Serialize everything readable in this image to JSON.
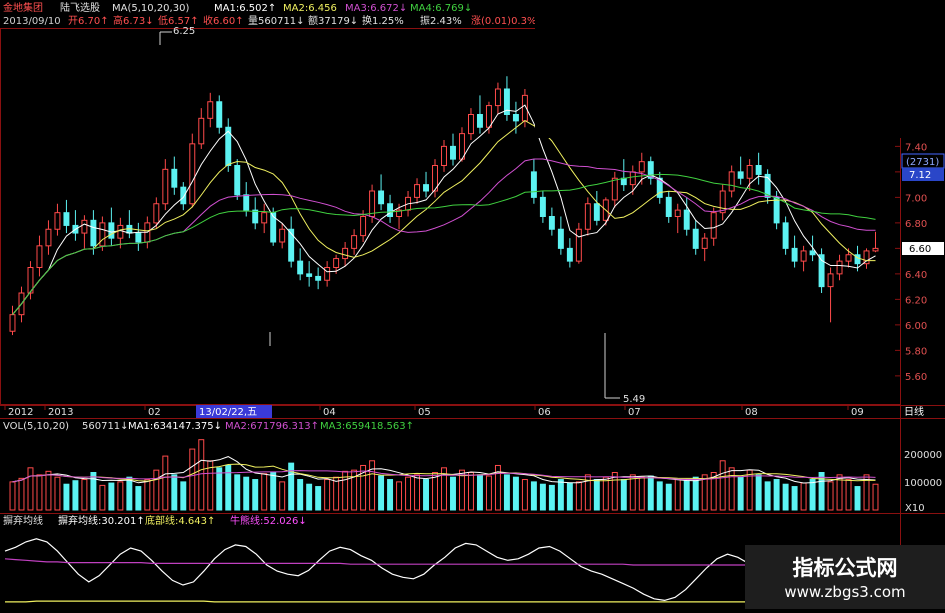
{
  "header": {
    "stock": "金地集团",
    "formula": "陆飞选股",
    "ma_label": "MA(5,10,20,30)",
    "ma1": "MA1:6.502↑",
    "ma2": "MA2:6.456",
    "ma3": "MA3:6.672↓",
    "ma4": "MA4:6.769↓",
    "date": "2013/09/10",
    "open": "开6.70↑",
    "high": "高6.73↓",
    "low": "低6.57↑",
    "close": "收6.60↑",
    "volume": "量560711↓",
    "amount": "额37179↓",
    "turnover": "换1.25%",
    "amplitude": "振2.43%",
    "change": "涨(0.01)0.3%"
  },
  "vol_header": {
    "label": "VOL(5,10,20)",
    "value": "560711↓",
    "ma1": "MA1:634147.375↓",
    "ma2": "MA2:671796.313↑",
    "ma3": "MA3:659418.563↑"
  },
  "ind_header": {
    "name": "摒弃均线",
    "line1": "摒弃均线:30.201↑",
    "line2": "底部线:4.643↑",
    "line3": "牛熊线:52.026↓"
  },
  "annotations": {
    "high_mark": "6.25",
    "low_mark": "5.49",
    "cursor_date": "13/02/22,五",
    "period": "日线",
    "ref_code": "(2731)",
    "ref_price": "7.12",
    "current_price": "6.60",
    "vol_unit": "X10"
  },
  "axis": {
    "x_labels": [
      "2012",
      "2013",
      "02",
      "04",
      "05",
      "06",
      "07",
      "08",
      "09"
    ],
    "price_ticks": [
      "7.40",
      "7.20",
      "7.00",
      "6.80",
      "6.60",
      "6.40",
      "6.20",
      "6.00",
      "5.80",
      "5.60"
    ],
    "vol_ticks": [
      "200000",
      "100000"
    ]
  },
  "colors": {
    "up": "#ff4a4a",
    "down": "#5cf2f2",
    "ma1": "#ffffff",
    "ma2": "#f0f060",
    "ma3": "#d050d0",
    "ma4": "#40d040",
    "grid": "#8a1010"
  },
  "watermark": {
    "main": "指标公式网",
    "sub": "www.zbgs3.com"
  },
  "chart_data": {
    "type": "candlestick",
    "title": "金地集团",
    "period": "日线",
    "ylim": [
      5.45,
      7.45
    ],
    "candles": [
      [
        5.95,
        6.15,
        5.92,
        6.08
      ],
      [
        6.08,
        6.3,
        6.02,
        6.25
      ],
      [
        6.25,
        6.5,
        6.2,
        6.45
      ],
      [
        6.45,
        6.7,
        6.38,
        6.62
      ],
      [
        6.62,
        6.82,
        6.55,
        6.75
      ],
      [
        6.75,
        6.95,
        6.7,
        6.88
      ],
      [
        6.88,
        6.98,
        6.72,
        6.78
      ],
      [
        6.78,
        6.9,
        6.66,
        6.72
      ],
      [
        6.72,
        6.86,
        6.6,
        6.82
      ],
      [
        6.82,
        6.9,
        6.55,
        6.62
      ],
      [
        6.62,
        6.85,
        6.58,
        6.8
      ],
      [
        6.8,
        6.92,
        6.62,
        6.68
      ],
      [
        6.68,
        6.84,
        6.6,
        6.78
      ],
      [
        6.78,
        6.9,
        6.68,
        6.72
      ],
      [
        6.72,
        6.8,
        6.58,
        6.65
      ],
      [
        6.65,
        6.85,
        6.6,
        6.8
      ],
      [
        6.8,
        7.0,
        6.76,
        6.95
      ],
      [
        6.95,
        7.3,
        6.9,
        7.22
      ],
      [
        7.22,
        7.32,
        7.02,
        7.08
      ],
      [
        7.08,
        7.12,
        6.9,
        6.95
      ],
      [
        6.95,
        7.5,
        6.92,
        7.42
      ],
      [
        7.42,
        7.7,
        7.38,
        7.62
      ],
      [
        7.62,
        7.82,
        7.55,
        7.75
      ],
      [
        7.75,
        7.8,
        7.5,
        7.55
      ],
      [
        7.55,
        7.62,
        7.2,
        7.25
      ],
      [
        7.25,
        7.3,
        6.98,
        7.02
      ],
      [
        7.02,
        7.12,
        6.85,
        6.9
      ],
      [
        6.9,
        7.0,
        6.75,
        6.8
      ],
      [
        6.8,
        6.95,
        6.72,
        6.88
      ],
      [
        6.88,
        6.92,
        6.62,
        6.65
      ],
      [
        6.65,
        6.8,
        6.6,
        6.75
      ],
      [
        6.75,
        6.85,
        6.45,
        6.5
      ],
      [
        6.5,
        6.6,
        6.35,
        6.4
      ],
      [
        6.4,
        6.5,
        6.3,
        6.38
      ],
      [
        6.38,
        6.45,
        6.28,
        6.35
      ],
      [
        6.35,
        6.5,
        6.3,
        6.45
      ],
      [
        6.45,
        6.55,
        6.4,
        6.52
      ],
      [
        6.52,
        6.65,
        6.46,
        6.6
      ],
      [
        6.6,
        6.75,
        6.55,
        6.7
      ],
      [
        6.7,
        6.9,
        6.65,
        6.85
      ],
      [
        6.85,
        7.1,
        6.8,
        7.05
      ],
      [
        7.05,
        7.18,
        6.9,
        6.95
      ],
      [
        6.95,
        7.02,
        6.8,
        6.85
      ],
      [
        6.85,
        6.95,
        6.75,
        6.9
      ],
      [
        6.9,
        7.05,
        6.85,
        7.0
      ],
      [
        7.0,
        7.15,
        6.95,
        7.1
      ],
      [
        7.1,
        7.2,
        7.0,
        7.05
      ],
      [
        7.05,
        7.3,
        7.0,
        7.25
      ],
      [
        7.25,
        7.45,
        7.2,
        7.4
      ],
      [
        7.4,
        7.5,
        7.25,
        7.3
      ],
      [
        7.3,
        7.55,
        7.28,
        7.5
      ],
      [
        7.5,
        7.7,
        7.45,
        7.65
      ],
      [
        7.65,
        7.8,
        7.5,
        7.55
      ],
      [
        7.55,
        7.75,
        7.5,
        7.72
      ],
      [
        7.72,
        7.9,
        7.65,
        7.85
      ],
      [
        7.85,
        7.95,
        7.6,
        7.65
      ],
      [
        7.65,
        7.75,
        7.5,
        7.6
      ],
      [
        7.6,
        7.85,
        7.55,
        7.8
      ],
      [
        7.2,
        7.3,
        6.95,
        7.0
      ],
      [
        7.0,
        7.05,
        6.8,
        6.85
      ],
      [
        6.85,
        6.92,
        6.7,
        6.75
      ],
      [
        6.75,
        6.85,
        6.55,
        6.6
      ],
      [
        6.6,
        6.68,
        6.45,
        6.5
      ],
      [
        6.5,
        6.8,
        6.48,
        6.75
      ],
      [
        6.75,
        7.0,
        6.7,
        6.95
      ],
      [
        6.95,
        7.05,
        6.78,
        6.82
      ],
      [
        6.82,
        7.0,
        6.78,
        6.98
      ],
      [
        6.98,
        7.2,
        6.92,
        7.15
      ],
      [
        7.15,
        7.3,
        7.05,
        7.1
      ],
      [
        7.1,
        7.25,
        7.02,
        7.2
      ],
      [
        7.2,
        7.35,
        7.1,
        7.28
      ],
      [
        7.28,
        7.32,
        7.1,
        7.15
      ],
      [
        7.15,
        7.2,
        6.95,
        7.0
      ],
      [
        7.0,
        7.05,
        6.8,
        6.85
      ],
      [
        6.85,
        6.95,
        6.72,
        6.9
      ],
      [
        6.9,
        7.0,
        6.7,
        6.75
      ],
      [
        6.75,
        6.82,
        6.55,
        6.6
      ],
      [
        6.6,
        6.72,
        6.5,
        6.68
      ],
      [
        6.68,
        6.92,
        6.62,
        6.88
      ],
      [
        6.88,
        7.1,
        6.82,
        7.05
      ],
      [
        7.05,
        7.25,
        7.0,
        7.2
      ],
      [
        7.2,
        7.32,
        7.1,
        7.15
      ],
      [
        7.15,
        7.3,
        7.05,
        7.25
      ],
      [
        7.25,
        7.35,
        7.1,
        7.18
      ],
      [
        7.18,
        7.22,
        6.95,
        7.0
      ],
      [
        7.0,
        7.05,
        6.75,
        6.8
      ],
      [
        6.8,
        6.85,
        6.55,
        6.6
      ],
      [
        6.6,
        6.7,
        6.45,
        6.5
      ],
      [
        6.5,
        6.62,
        6.42,
        6.58
      ],
      [
        6.58,
        6.7,
        6.5,
        6.55
      ],
      [
        6.55,
        6.6,
        6.25,
        6.3
      ],
      [
        6.3,
        6.45,
        6.02,
        6.4
      ],
      [
        6.4,
        6.55,
        6.35,
        6.5
      ],
      [
        6.5,
        6.6,
        6.45,
        6.55
      ],
      [
        6.55,
        6.62,
        6.42,
        6.48
      ],
      [
        6.48,
        6.6,
        6.44,
        6.58
      ],
      [
        6.58,
        6.73,
        6.57,
        6.6
      ]
    ],
    "volume": [
      120,
      135,
      180,
      150,
      165,
      140,
      110,
      125,
      130,
      160,
      105,
      115,
      120,
      140,
      100,
      130,
      170,
      230,
      150,
      120,
      260,
      300,
      210,
      180,
      190,
      150,
      140,
      130,
      155,
      160,
      120,
      200,
      130,
      110,
      100,
      130,
      140,
      165,
      170,
      190,
      210,
      145,
      130,
      120,
      140,
      150,
      130,
      160,
      180,
      140,
      170,
      160,
      150,
      145,
      190,
      150,
      140,
      130,
      120,
      110,
      105,
      130,
      115,
      120,
      150,
      130,
      140,
      160,
      130,
      150,
      140,
      145,
      120,
      110,
      130,
      125,
      140,
      150,
      160,
      210,
      180,
      140,
      170,
      150,
      120,
      130,
      110,
      100,
      115,
      130,
      160,
      120,
      150,
      130,
      100,
      150,
      110
    ],
    "indicator": {
      "name": "摒弃均线",
      "series": [
        {
          "name": "摒弃均线",
          "values": [
            70,
            75,
            82,
            86,
            82,
            70,
            55,
            40,
            30,
            38,
            52,
            66,
            74,
            70,
            58,
            44,
            32,
            26,
            30,
            44,
            60,
            72,
            78,
            76,
            66,
            52,
            44,
            40,
            38,
            45,
            58,
            70,
            75,
            72,
            64,
            58,
            48,
            40,
            36,
            34,
            40,
            52,
            62,
            74,
            80,
            78,
            70,
            62,
            58,
            60,
            66,
            74,
            76,
            70,
            60,
            50,
            44,
            40,
            34,
            28,
            22,
            14,
            8,
            6,
            10,
            20,
            34,
            48,
            60,
            66,
            62,
            54,
            44,
            36,
            28,
            30,
            38,
            48,
            58,
            62,
            60,
            54,
            46,
            42,
            44,
            50
          ]
        },
        {
          "name": "底部线",
          "values": [
            4,
            4,
            4,
            5,
            5,
            5,
            5,
            5,
            5,
            5,
            5,
            5,
            5,
            5,
            5,
            5,
            5,
            5,
            5,
            5,
            4,
            4,
            4,
            4,
            4,
            4,
            4,
            4,
            4,
            4,
            4,
            4,
            4,
            4,
            4,
            4,
            4,
            4,
            4,
            4,
            4,
            4,
            4,
            4,
            4,
            4,
            4,
            4,
            4,
            4,
            4,
            4,
            4,
            4,
            4,
            4,
            4,
            4,
            4,
            4,
            4,
            4,
            4,
            4,
            4,
            4,
            4,
            4,
            4,
            4,
            4,
            4,
            4,
            4,
            4,
            4,
            4,
            4,
            4,
            4,
            4,
            4,
            4,
            4,
            4,
            4
          ]
        },
        {
          "name": "牛熊线",
          "values": [
            60,
            59,
            58,
            57,
            56,
            56,
            55,
            55,
            55,
            55,
            55,
            55,
            55,
            55,
            54,
            54,
            54,
            54,
            54,
            54,
            54,
            54,
            54,
            54,
            54,
            54,
            54,
            54,
            54,
            54,
            54,
            54,
            54,
            53,
            53,
            53,
            53,
            53,
            53,
            53,
            53,
            53,
            53,
            53,
            53,
            53,
            53,
            53,
            53,
            53,
            53,
            53,
            53,
            53,
            53,
            53,
            53,
            53,
            53,
            53,
            52,
            52,
            52,
            52,
            52,
            52,
            52,
            52,
            52,
            52,
            52,
            52,
            52,
            52,
            52,
            52,
            52,
            52,
            52,
            52,
            52,
            52,
            52,
            52,
            52,
            52
          ]
        }
      ]
    }
  }
}
